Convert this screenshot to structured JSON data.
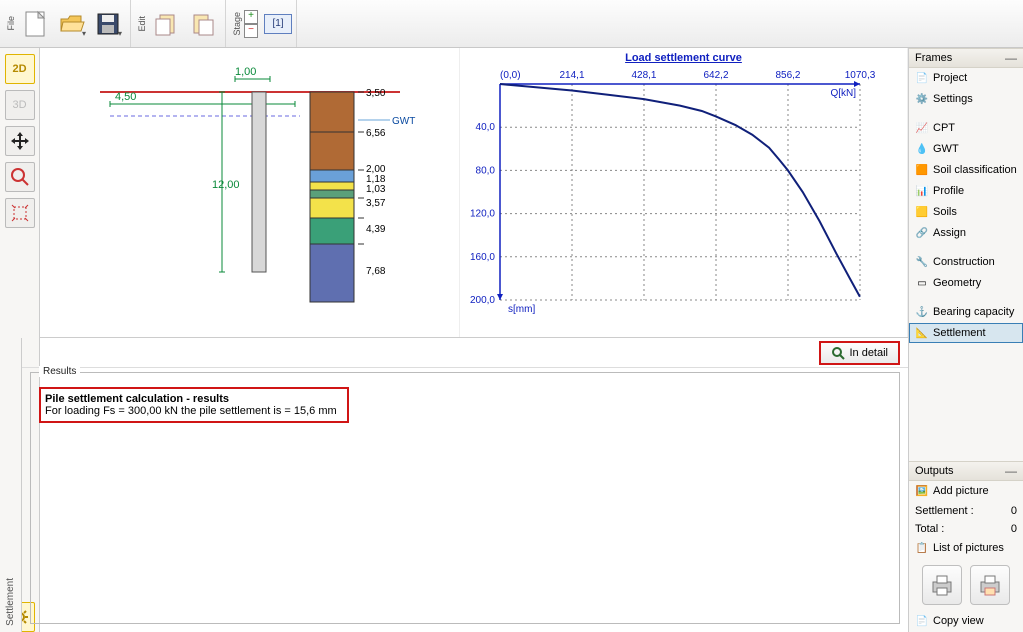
{
  "toolbar": {
    "file_label": "File",
    "edit_label": "Edit",
    "stage_label": "Stage",
    "stage_value": "[1]"
  },
  "left_tools": {
    "view2d": "2D",
    "view3d": "3D"
  },
  "pile_view": {
    "dim_top": "1,00",
    "dim_width": "4,50",
    "dim_length": "12,00",
    "gwt_label": "GWT",
    "layer_labels": [
      "3,50",
      "6,56",
      "2,00",
      "1,18",
      "1,03",
      "3,57",
      "4,39",
      "7,68"
    ]
  },
  "frames": {
    "title": "Frames",
    "items": [
      "Project",
      "Settings",
      "CPT",
      "GWT",
      "Soil classification",
      "Profile",
      "Soils",
      "Assign",
      "Construction",
      "Geometry",
      "Bearing capacity",
      "Settlement"
    ]
  },
  "outputs": {
    "title": "Outputs",
    "add_picture": "Add picture",
    "settlement_label": "Settlement :",
    "settlement_val": "0",
    "total_label": "Total :",
    "total_val": "0",
    "list_of_pictures": "List of pictures",
    "copy_view": "Copy view"
  },
  "bottom": {
    "tab": "Settlement",
    "in_detail": "In detail",
    "results_legend": "Results",
    "result_title": "Pile settlement calculation - results",
    "result_text": "For loading Fs = 300,00 kN the pile settlement is = 15,6 mm"
  },
  "chart_data": {
    "type": "line",
    "title": "Load settlement curve",
    "xlabel": "Q[kN]",
    "ylabel": "s[mm]",
    "x_ticks": [
      0,
      214.1,
      428.1,
      642.2,
      856.2,
      1070.3
    ],
    "x_tick_labels": [
      "(0,0)",
      "214,1",
      "428,1",
      "642,2",
      "856,2",
      "1070,3"
    ],
    "y_ticks": [
      0,
      40,
      80,
      120,
      160,
      200
    ],
    "y_tick_labels": [
      "",
      "40,0",
      "80,0",
      "120,0",
      "160,0",
      "200,0"
    ],
    "xlim": [
      0,
      1070.3
    ],
    "ylim": [
      0,
      200
    ],
    "series": [
      {
        "name": "settlement",
        "x": [
          0,
          107,
          214,
          321,
          428,
          535,
          600,
          642,
          700,
          750,
          800,
          830,
          856,
          900,
          950,
          1000,
          1040,
          1070
        ],
        "y": [
          0,
          3,
          6,
          10,
          14,
          20,
          25,
          30,
          38,
          47,
          59,
          70,
          80,
          100,
          127,
          157,
          180,
          197
        ]
      }
    ]
  }
}
